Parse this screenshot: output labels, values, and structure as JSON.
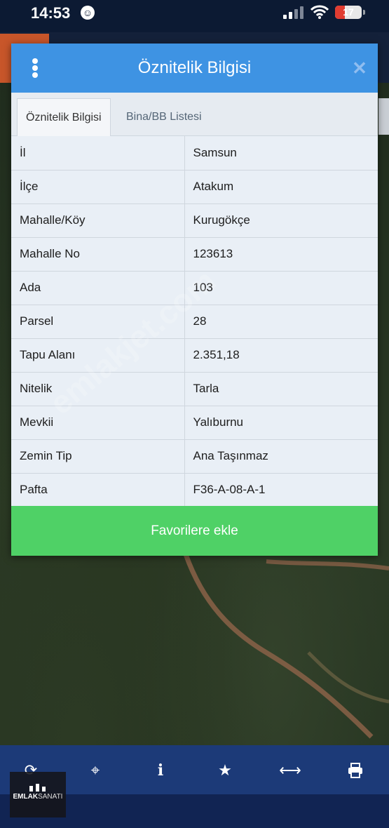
{
  "status_bar": {
    "time": "14:53",
    "battery_level": "17",
    "battery_fraction": 0.17
  },
  "dialog": {
    "title": "Öznitelik Bilgisi",
    "tabs": [
      {
        "label": "Öznitelik Bilgisi",
        "active": true
      },
      {
        "label": "Bina/BB Listesi",
        "active": false
      }
    ],
    "rows": [
      {
        "key": "İl",
        "value": "Samsun"
      },
      {
        "key": "İlçe",
        "value": "Atakum"
      },
      {
        "key": "Mahalle/Köy",
        "value": "Kurugökçe"
      },
      {
        "key": "Mahalle No",
        "value": "123613"
      },
      {
        "key": "Ada",
        "value": "103"
      },
      {
        "key": "Parsel",
        "value": "28"
      },
      {
        "key": "Tapu Alanı",
        "value": "2.351,18"
      },
      {
        "key": "Nitelik",
        "value": "Tarla"
      },
      {
        "key": "Mevkii",
        "value": "Yalıburnu"
      },
      {
        "key": "Zemin Tip",
        "value": "Ana Taşınmaz"
      },
      {
        "key": "Pafta",
        "value": "F36-A-08-A-1"
      }
    ],
    "favorite_button": "Favorilere ekle"
  },
  "watermark": "emlakjet.com",
  "toolbar": {
    "icons": [
      "refresh-icon",
      "locate-icon",
      "info-icon",
      "star-icon",
      "measure-icon",
      "print-icon"
    ]
  },
  "logo": {
    "bold": "EMLAK",
    "light": "SANATI"
  },
  "colors": {
    "header": "#3e93e3",
    "favorite_button": "#4fd166",
    "toolbar": "#1c3a78"
  }
}
